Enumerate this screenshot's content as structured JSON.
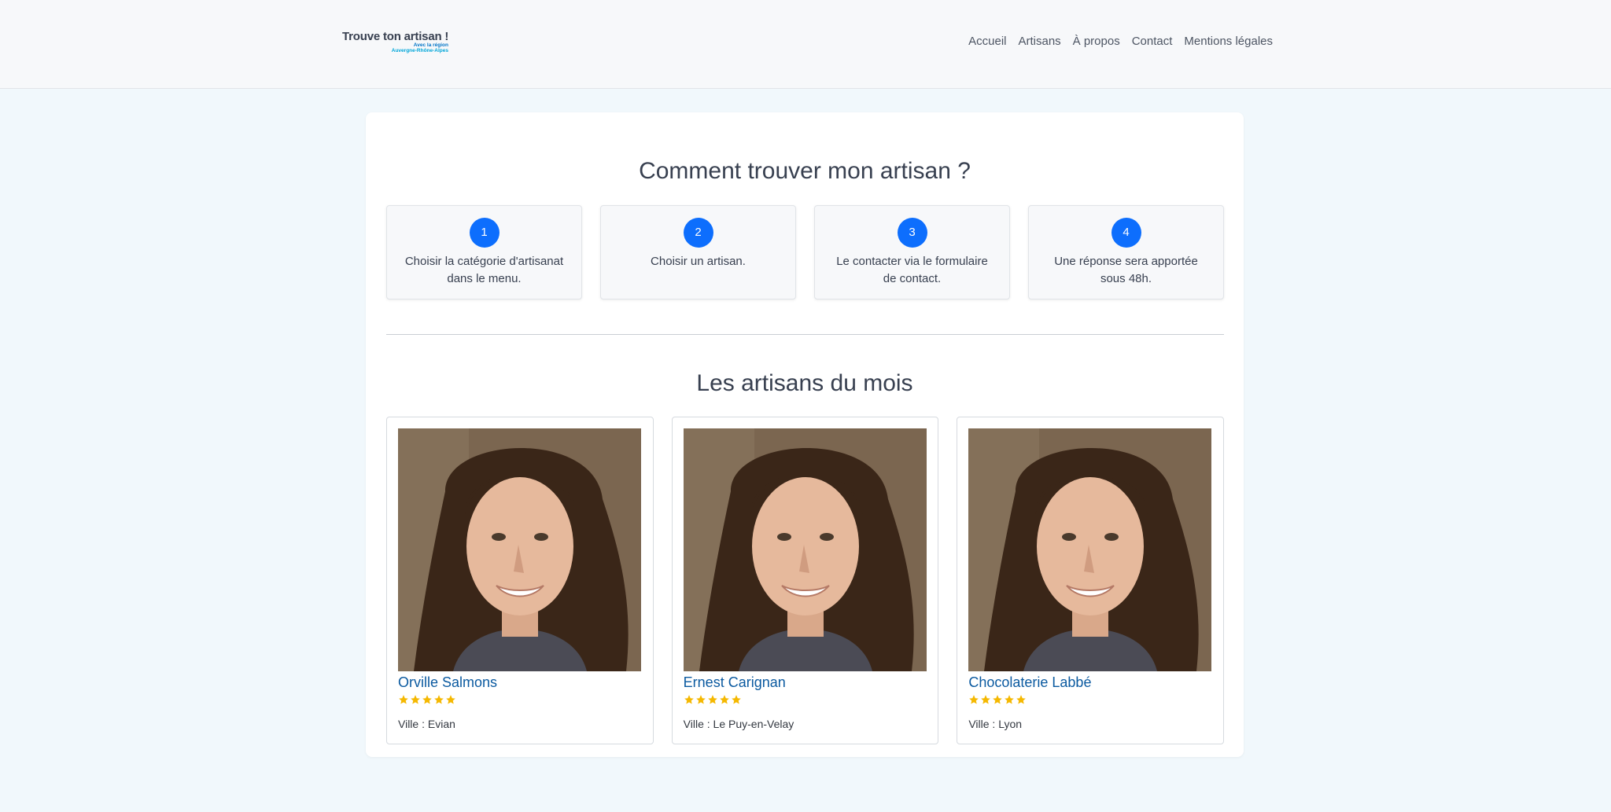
{
  "header": {
    "logo_title": "Trouve ton artisan !",
    "logo_sub1": "Avec la région",
    "logo_sub2": "Auvergne-Rhône-Alpes",
    "nav": [
      {
        "label": "Accueil"
      },
      {
        "label": "Artisans"
      },
      {
        "label": "À propos"
      },
      {
        "label": "Contact"
      },
      {
        "label": "Mentions légales"
      }
    ]
  },
  "steps_section": {
    "title": "Comment trouver mon artisan ?",
    "steps": [
      {
        "number": "1",
        "text": "Choisir la catégorie d'artisanat dans le menu."
      },
      {
        "number": "2",
        "text": "Choisir un artisan."
      },
      {
        "number": "3",
        "text": "Le contacter via le formulaire de contact."
      },
      {
        "number": "4",
        "text": "Une réponse sera apportée sous 48h."
      }
    ]
  },
  "artisans_section": {
    "title": "Les artisans du mois",
    "artisans": [
      {
        "name": "Orville Salmons",
        "rating": 5,
        "city": "Ville : Evian"
      },
      {
        "name": "Ernest Carignan",
        "rating": 5,
        "city": "Ville : Le Puy-en-Velay"
      },
      {
        "name": "Chocolaterie Labbé",
        "rating": 5,
        "city": "Ville : Lyon"
      }
    ]
  },
  "colors": {
    "accent": "#0d6efd",
    "name_link": "#0b5aa0",
    "star": "#f5b800",
    "page_background": "#f1f8fc"
  }
}
